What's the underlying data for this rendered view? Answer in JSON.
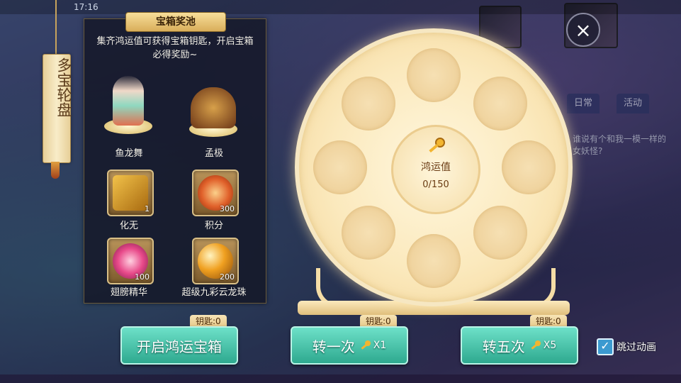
{
  "status": {
    "time": "17:16"
  },
  "scroll": {
    "title": "多宝轮盘"
  },
  "pool": {
    "title": "宝箱奖池",
    "description": "集齐鸿运值可获得宝箱钥匙，开启宝箱必得奖励~",
    "figures": [
      {
        "name": "鱼龙舞"
      },
      {
        "name": "孟极"
      }
    ],
    "items": [
      {
        "name": "化无",
        "qty": "1"
      },
      {
        "name": "积分",
        "qty": "300"
      },
      {
        "name": "翅膀精华",
        "qty": "100"
      },
      {
        "name": "超级九彩云龙珠",
        "qty": "200"
      }
    ]
  },
  "wheel": {
    "center_label": "鸿运值",
    "progress": "0/150",
    "progress_fraction": 0.0
  },
  "background": {
    "tab1": "日常",
    "tab2": "活动",
    "chat": "谁说有个和我一模一样的女妖怪?"
  },
  "buttons": {
    "open_chest": {
      "label": "开启鸿运宝箱",
      "key_tag": "钥匙:0"
    },
    "spin_once": {
      "label": "转一次",
      "mult": "X1",
      "key_tag": "钥匙:0"
    },
    "spin_five": {
      "label": "转五次",
      "mult": "X5",
      "key_tag": "钥匙:0"
    }
  },
  "skip": {
    "label": "跳过动画",
    "checked": true
  },
  "colors": {
    "button": "#2ea98f",
    "wheel": "#fbe9bd",
    "panel": "#14162a"
  }
}
